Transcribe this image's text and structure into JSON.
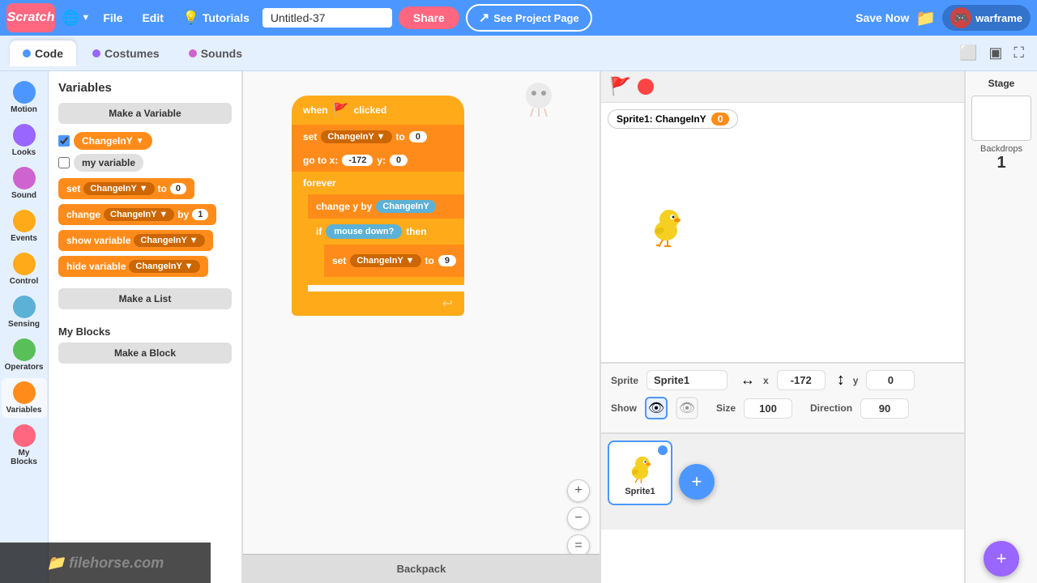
{
  "topbar": {
    "logo": "Scratch",
    "globe_label": "🌐",
    "file_label": "File",
    "edit_label": "Edit",
    "tutorials_label": "Tutorials",
    "project_title": "Untitled-37",
    "share_label": "Share",
    "see_project_label": "See Project Page",
    "save_now_label": "Save Now",
    "user_name": "warframe",
    "folder_icon": "📁"
  },
  "tabs": {
    "code_label": "Code",
    "costumes_label": "Costumes",
    "sounds_label": "Sounds"
  },
  "categories": [
    {
      "id": "motion",
      "label": "Motion",
      "color": "#4c97ff"
    },
    {
      "id": "looks",
      "label": "Looks",
      "color": "#9966ff"
    },
    {
      "id": "sound",
      "label": "Sound",
      "color": "#cf63cf"
    },
    {
      "id": "events",
      "label": "Events",
      "color": "#ffab19"
    },
    {
      "id": "control",
      "label": "Control",
      "color": "#ffab19"
    },
    {
      "id": "sensing",
      "label": "Sensing",
      "color": "#5cb1d6"
    },
    {
      "id": "operators",
      "label": "Operators",
      "color": "#59c059"
    },
    {
      "id": "variables",
      "label": "Variables",
      "color": "#ff8c1a"
    },
    {
      "id": "myblocks",
      "label": "My Blocks",
      "color": "#ff6680"
    }
  ],
  "variables_panel": {
    "title": "Variables",
    "make_var_label": "Make a Variable",
    "make_list_label": "Make a List",
    "make_block_label": "Make a Block",
    "var1_name": "ChangeInY",
    "var2_name": "my variable",
    "var1_checked": true,
    "var2_checked": false,
    "my_blocks_title": "My Blocks",
    "blocks": [
      {
        "type": "set",
        "label": "set",
        "var": "ChangeInY",
        "val": "0"
      },
      {
        "type": "change",
        "label": "change",
        "var": "ChangeInY",
        "by": "1"
      },
      {
        "type": "show",
        "label": "show variable",
        "var": "ChangeInY"
      },
      {
        "type": "hide",
        "label": "hide variable",
        "var": "ChangeInY"
      }
    ]
  },
  "script": {
    "blocks": [
      {
        "type": "hat",
        "label": "when",
        "flag": "🚩",
        "suffix": "clicked"
      },
      {
        "type": "set",
        "label": "set",
        "var": "ChangeInY",
        "to": "0"
      },
      {
        "type": "goto",
        "label": "go to x:",
        "x": "-172",
        "y": "0"
      },
      {
        "type": "forever",
        "label": "forever"
      },
      {
        "type": "change",
        "label": "change y by",
        "var": "ChangeInY"
      },
      {
        "type": "if",
        "label": "if",
        "cond": "mouse down?",
        "then": "then"
      },
      {
        "type": "set_inner",
        "label": "set",
        "var": "ChangeInY",
        "to": "9"
      }
    ]
  },
  "stage": {
    "sprite_label": "Sprite1: ChangeInY",
    "sprite_var_val": "0",
    "green_flag": "🚩",
    "stop_color": "#ff4444"
  },
  "sprite_props": {
    "sprite_label": "Sprite",
    "sprite_name": "Sprite1",
    "x_label": "x",
    "x_val": "-172",
    "y_label": "y",
    "y_val": "0",
    "show_label": "Show",
    "size_label": "Size",
    "size_val": "100",
    "direction_label": "Direction",
    "direction_val": "90"
  },
  "sprites_list": [
    {
      "name": "Sprite1",
      "selected": true
    }
  ],
  "stage_panel": {
    "label": "Stage",
    "backdrops_label": "Backdrops",
    "backdrops_count": "1"
  },
  "backpack": {
    "label": "Backpack"
  },
  "zoom": {
    "zoom_in": "+",
    "zoom_out": "−",
    "zoom_reset": "="
  }
}
